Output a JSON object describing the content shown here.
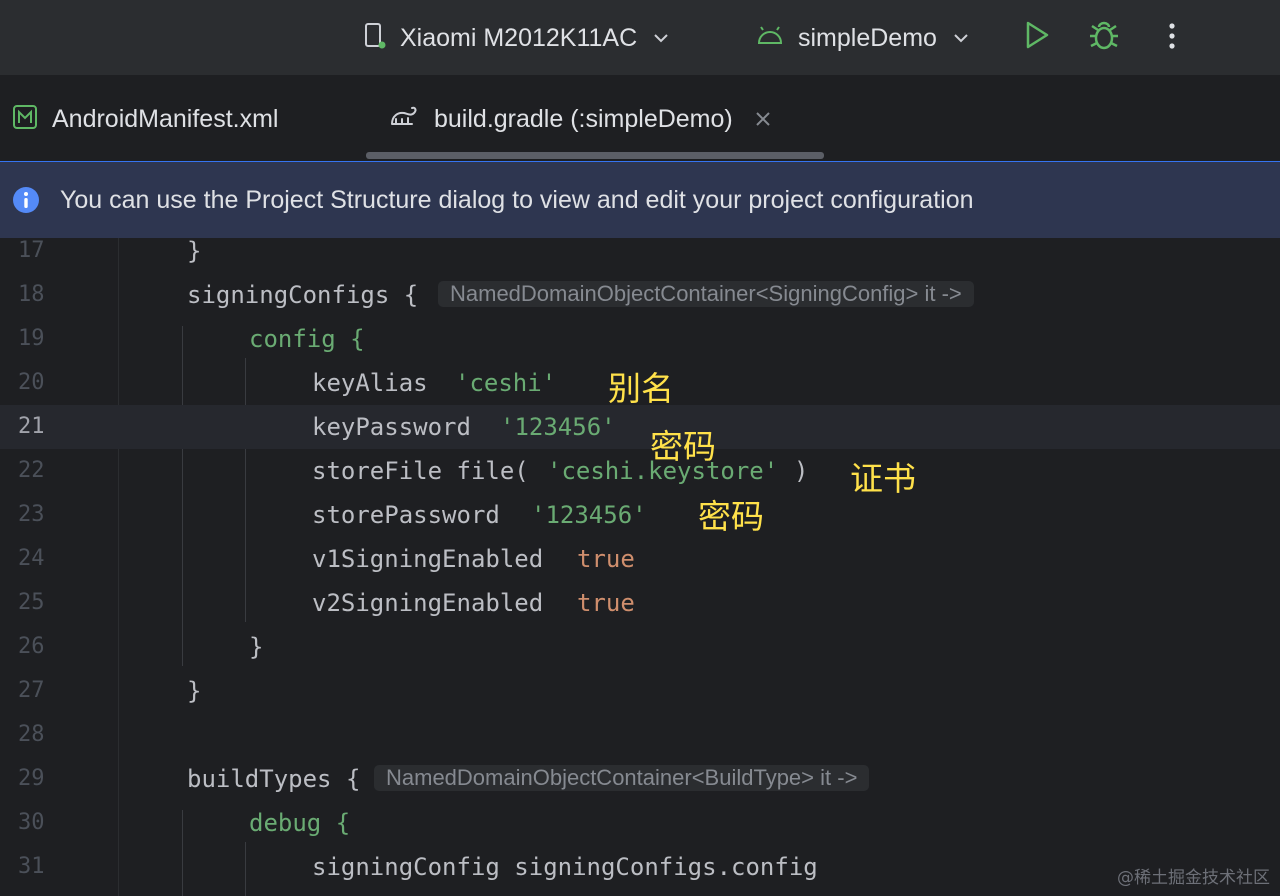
{
  "toolbar": {
    "device_label": "Xiaomi M2012K11AC",
    "config_label": "simpleDemo",
    "device_icon": "phone-icon",
    "config_icon": "android-icon",
    "run_icon": "run-icon",
    "debug_icon": "debug-icon",
    "more_icon": "more-vertical-icon"
  },
  "tabs": [
    {
      "label": "AndroidManifest.xml",
      "icon": "manifest-icon",
      "active": false
    },
    {
      "label": "build.gradle (:simpleDemo)",
      "icon": "gradle-icon",
      "active": true
    }
  ],
  "banner": {
    "text": "You can use the Project Structure dialog to view and edit your project configuration"
  },
  "editor": {
    "current_line": "21",
    "lines": [
      {
        "num": "17",
        "code": "}"
      },
      {
        "num": "18",
        "code": "signingConfigs {",
        "hint": "NamedDomainObjectContainer<SigningConfig> it ->"
      },
      {
        "num": "19",
        "code": "config {"
      },
      {
        "num": "20",
        "code": "keyAlias",
        "str": "'ceshi'"
      },
      {
        "num": "21",
        "code": "keyPassword",
        "str": "'123456'"
      },
      {
        "num": "22",
        "code_a": "storeFile file(",
        "str": "'ceshi.keystore'",
        "code_b": ")"
      },
      {
        "num": "23",
        "code": "storePassword",
        "str": "'123456'"
      },
      {
        "num": "24",
        "code": "v1SigningEnabled",
        "kw": "true"
      },
      {
        "num": "25",
        "code": "v2SigningEnabled",
        "kw": "true"
      },
      {
        "num": "26",
        "code": "}"
      },
      {
        "num": "27",
        "code": "}"
      },
      {
        "num": "28",
        "code": ""
      },
      {
        "num": "29",
        "code": "buildTypes {",
        "hint": "NamedDomainObjectContainer<BuildType> it ->"
      },
      {
        "num": "30",
        "code": "debug {"
      },
      {
        "num": "31",
        "code": "signingConfig signingConfigs.config"
      }
    ],
    "annotations": [
      "别名",
      "密码",
      "证书",
      "密码"
    ]
  },
  "watermark": "@稀土掘金技术社区",
  "colors": {
    "background": "#1e1f22",
    "toolbar": "#2b2d30",
    "banner": "#2e3650",
    "string": "#6aab73",
    "keyword": "#cf8e6d",
    "annotation": "#ffe14a",
    "accent": "#3574f0"
  }
}
